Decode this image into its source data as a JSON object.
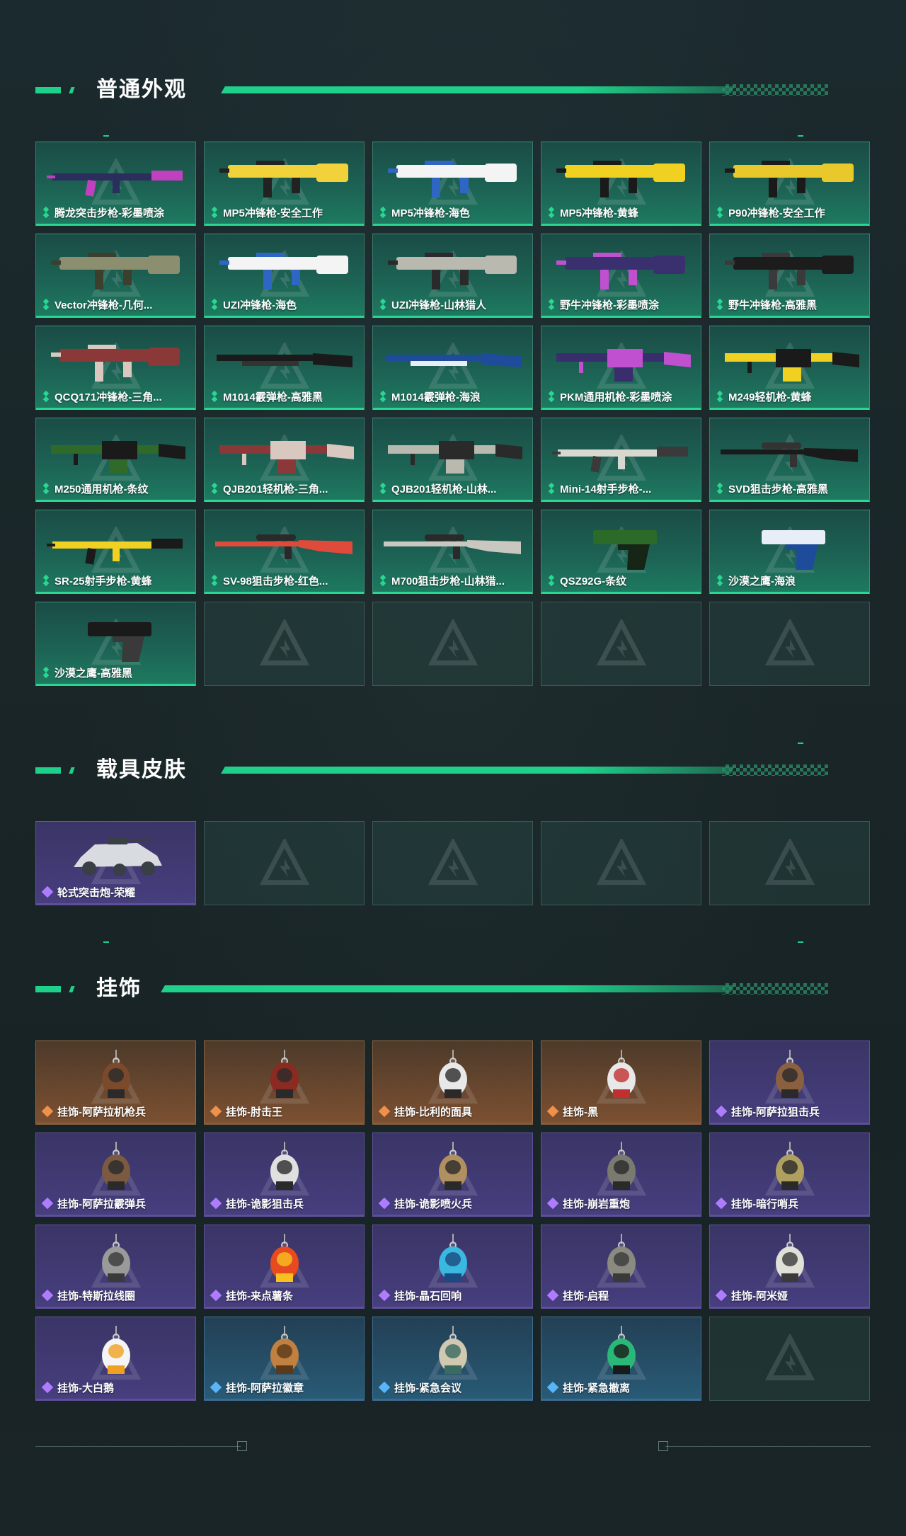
{
  "sections": {
    "weapons": {
      "title": "普通外观"
    },
    "vehicles": {
      "title": "载具皮肤"
    },
    "charms": {
      "title": "挂饰"
    }
  },
  "colors": {
    "accent": "#1fd08a",
    "green_rarity": "#29d792",
    "purple_rarity": "#9a6bff",
    "orange_rarity": "#e0894a",
    "blue_rarity": "#4aa4e8"
  },
  "weapons": [
    {
      "label": "腾龙突击步枪-彩墨喷涂",
      "rarity": "green",
      "icon": "rifle-icon",
      "palette": [
        "#2b2d5c",
        "#c040c0"
      ]
    },
    {
      "label": "MP5冲锋枪-安全工作",
      "rarity": "green",
      "icon": "smg-icon",
      "palette": [
        "#f2d23b",
        "#222222"
      ]
    },
    {
      "label": "MP5冲锋枪-海色",
      "rarity": "green",
      "icon": "smg-icon",
      "palette": [
        "#f4f4f4",
        "#2e66c4"
      ]
    },
    {
      "label": "MP5冲锋枪-黄蜂",
      "rarity": "green",
      "icon": "smg-icon",
      "palette": [
        "#f0d020",
        "#1a1a1a"
      ]
    },
    {
      "label": "P90冲锋枪-安全工作",
      "rarity": "green",
      "icon": "smg-icon",
      "palette": [
        "#e8c82a",
        "#1a1a1a"
      ]
    },
    {
      "label": "Vector冲锋枪-几何...",
      "rarity": "green",
      "icon": "smg-icon",
      "palette": [
        "#8b8f70",
        "#3c3f2c"
      ]
    },
    {
      "label": "UZI冲锋枪-海色",
      "rarity": "green",
      "icon": "smg-icon",
      "palette": [
        "#f4f4f4",
        "#2e66c4"
      ]
    },
    {
      "label": "UZI冲锋枪-山林猎人",
      "rarity": "green",
      "icon": "smg-icon",
      "palette": [
        "#b9b9b0",
        "#2a2a2a"
      ]
    },
    {
      "label": "野牛冲锋枪-彩墨喷涂",
      "rarity": "green",
      "icon": "smg-icon",
      "palette": [
        "#3a3070",
        "#c050d0"
      ]
    },
    {
      "label": "野牛冲锋枪-高雅黑",
      "rarity": "green",
      "icon": "smg-icon",
      "palette": [
        "#1c1c1c",
        "#3a3a3a"
      ]
    },
    {
      "label": "QCQ171冲锋枪-三角...",
      "rarity": "green",
      "icon": "smg-icon",
      "palette": [
        "#8a3838",
        "#d8c8c0"
      ]
    },
    {
      "label": "M1014霰弹枪-高雅黑",
      "rarity": "green",
      "icon": "shotgun-icon",
      "palette": [
        "#1a1a1a",
        "#333333"
      ]
    },
    {
      "label": "M1014霰弹枪-海浪",
      "rarity": "green",
      "icon": "shotgun-icon",
      "palette": [
        "#1f4c9a",
        "#e8eef8"
      ]
    },
    {
      "label": "PKM通用机枪-彩墨喷涂",
      "rarity": "green",
      "icon": "machine-gun-icon",
      "palette": [
        "#3a2d6e",
        "#c050d0"
      ]
    },
    {
      "label": "M249轻机枪-黄蜂",
      "rarity": "green",
      "icon": "machine-gun-icon",
      "palette": [
        "#f0d020",
        "#1a1a1a"
      ]
    },
    {
      "label": "M250通用机枪-条纹",
      "rarity": "green",
      "icon": "machine-gun-icon",
      "palette": [
        "#2f6a2a",
        "#1a1a1a"
      ]
    },
    {
      "label": "QJB201轻机枪-三角...",
      "rarity": "green",
      "icon": "machine-gun-icon",
      "palette": [
        "#8a3838",
        "#d8c8c0"
      ]
    },
    {
      "label": "QJB201轻机枪-山林...",
      "rarity": "green",
      "icon": "machine-gun-icon",
      "palette": [
        "#b9b9b0",
        "#2a2a2a"
      ]
    },
    {
      "label": "Mini-14射手步枪-...",
      "rarity": "green",
      "icon": "rifle-icon",
      "palette": [
        "#d8d8d0",
        "#3a3a3a"
      ]
    },
    {
      "label": "SVD狙击步枪-高雅黑",
      "rarity": "green",
      "icon": "sniper-icon",
      "palette": [
        "#1a1a1a",
        "#333333"
      ]
    },
    {
      "label": "SR-25射手步枪-黄蜂",
      "rarity": "green",
      "icon": "rifle-icon",
      "palette": [
        "#f0d020",
        "#1a1a1a"
      ]
    },
    {
      "label": "SV-98狙击步枪-红色...",
      "rarity": "green",
      "icon": "sniper-icon",
      "palette": [
        "#e04a3a",
        "#2a2a2a"
      ]
    },
    {
      "label": "M700狙击步枪-山林猎...",
      "rarity": "green",
      "icon": "sniper-icon",
      "palette": [
        "#c8c8c0",
        "#2a2a2a"
      ]
    },
    {
      "label": "QSZ92G-条纹",
      "rarity": "green",
      "icon": "pistol-icon",
      "palette": [
        "#2c6a2a",
        "#162516"
      ]
    },
    {
      "label": "沙漠之鹰-海浪",
      "rarity": "green",
      "icon": "pistol-icon",
      "palette": [
        "#e8eef8",
        "#1f4c9a"
      ]
    },
    {
      "label": "沙漠之鹰-高雅黑",
      "rarity": "green",
      "icon": "pistol-icon",
      "palette": [
        "#1a1a1a",
        "#3a3a3a"
      ]
    },
    {
      "empty": true
    },
    {
      "empty": true
    },
    {
      "empty": true
    },
    {
      "empty": true
    }
  ],
  "vehicles": [
    {
      "label": "轮式突击炮-荣耀",
      "rarity": "purple",
      "icon": "vehicle-icon",
      "palette": [
        "#d8dce0",
        "#3a3f45"
      ]
    },
    {
      "empty": true
    },
    {
      "empty": true
    },
    {
      "empty": true
    },
    {
      "empty": true
    }
  ],
  "charms": [
    {
      "label": "挂饰-阿萨拉机枪兵",
      "rarity": "orange",
      "icon": "figure-charm-icon",
      "palette": [
        "#7a4a2a",
        "#2a2a2a"
      ]
    },
    {
      "label": "挂饰-肘击王",
      "rarity": "orange",
      "icon": "figure-charm-icon",
      "palette": [
        "#8a2a20",
        "#2a2a2a"
      ]
    },
    {
      "label": "挂饰-比利的面具",
      "rarity": "orange",
      "icon": "mask-charm-icon",
      "palette": [
        "#e8e8e8",
        "#2a2a2a"
      ]
    },
    {
      "label": "挂饰-黑",
      "rarity": "orange",
      "icon": "tag-charm-icon",
      "palette": [
        "#e8e8e8",
        "#c03030"
      ]
    },
    {
      "label": "挂饰-阿萨拉狙击兵",
      "rarity": "purple",
      "icon": "figure-charm-icon",
      "palette": [
        "#8a6040",
        "#2a2a2a"
      ]
    },
    {
      "label": "挂饰-阿萨拉霰弹兵",
      "rarity": "purple",
      "icon": "figure-charm-icon",
      "palette": [
        "#7a5a40",
        "#2a2a2a"
      ]
    },
    {
      "label": "挂饰-诡影狙击兵",
      "rarity": "purple",
      "icon": "figure-charm-icon",
      "palette": [
        "#e0e0e0",
        "#2a2a2a"
      ]
    },
    {
      "label": "挂饰-诡影喷火兵",
      "rarity": "purple",
      "icon": "figure-charm-icon",
      "palette": [
        "#b09060",
        "#2a2a2a"
      ]
    },
    {
      "label": "挂饰-崩岩重炮",
      "rarity": "purple",
      "icon": "figure-charm-icon",
      "palette": [
        "#7a7a70",
        "#2a2a2a"
      ]
    },
    {
      "label": "挂饰-暗行哨兵",
      "rarity": "purple",
      "icon": "figure-charm-icon",
      "palette": [
        "#b0a060",
        "#2a2a2a"
      ]
    },
    {
      "label": "挂饰-特斯拉线圈",
      "rarity": "purple",
      "icon": "coil-charm-icon",
      "palette": [
        "#9a9a9a",
        "#3a3a3a"
      ]
    },
    {
      "label": "挂饰-来点薯条",
      "rarity": "purple",
      "icon": "fries-charm-icon",
      "palette": [
        "#e84a20",
        "#f8c020"
      ]
    },
    {
      "label": "挂饰-晶石回响",
      "rarity": "purple",
      "icon": "crystal-charm-icon",
      "palette": [
        "#3ab8e0",
        "#1a4a80"
      ]
    },
    {
      "label": "挂饰-启程",
      "rarity": "purple",
      "icon": "ring-charm-icon",
      "palette": [
        "#8a8a80",
        "#3a3a3a"
      ]
    },
    {
      "label": "挂饰-阿米娅",
      "rarity": "purple",
      "icon": "bunny-charm-icon",
      "palette": [
        "#e0e0d8",
        "#3a3a3a"
      ]
    },
    {
      "label": "挂饰-大白鹅",
      "rarity": "purple",
      "icon": "goose-charm-icon",
      "palette": [
        "#f4f4f4",
        "#f0a020"
      ]
    },
    {
      "label": "挂饰-阿萨拉徽章",
      "rarity": "blue",
      "icon": "badge-charm-icon",
      "palette": [
        "#c08040",
        "#5a3a1a"
      ]
    },
    {
      "label": "挂饰-紧急会议",
      "rarity": "blue",
      "icon": "figure-charm-icon",
      "palette": [
        "#d0c8b0",
        "#3a6a60"
      ]
    },
    {
      "label": "挂饰-紧急撤离",
      "rarity": "blue",
      "icon": "box-charm-icon",
      "palette": [
        "#2ab878",
        "#1a1a1a"
      ]
    },
    {
      "empty": true
    }
  ]
}
